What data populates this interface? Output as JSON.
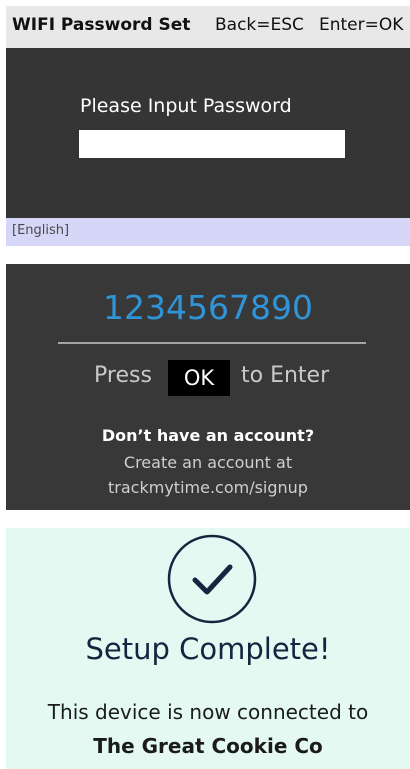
{
  "wifi_panel": {
    "title": "WIFI Password Set",
    "back_hint": "Back=ESC",
    "enter_hint": "Enter=OK",
    "prompt": "Please Input Password",
    "password_value": "",
    "language": "[English]"
  },
  "code_panel": {
    "code": "1234567890",
    "press_text": "Press",
    "ok_label": "OK",
    "to_enter_text": "to Enter",
    "account_question": "Don’t have an account?",
    "create_text": "Create an account at",
    "signup_url": "trackmytime.com/signup"
  },
  "complete_panel": {
    "icon": "checkmark-icon",
    "title": "Setup Complete!",
    "description": "This device is now connected to",
    "company": "The Great Cookie Co"
  },
  "colors": {
    "dark_panel": "#353535",
    "header_bar": "#e8e8e8",
    "language_bar": "#d6d6f8",
    "code_blue": "#2f95d8",
    "success_bg": "#e4f9f2",
    "success_navy": "#14253f"
  }
}
